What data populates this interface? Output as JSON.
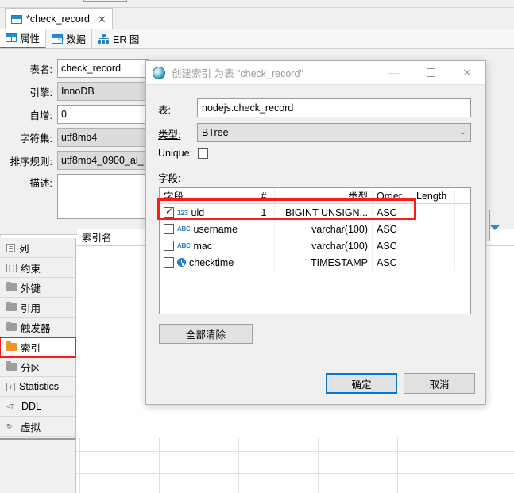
{
  "editor": {
    "tab_title": "*check_record",
    "close_label": "✕",
    "subtabs": [
      {
        "label": "属性",
        "icon": "table-icon",
        "active": true
      },
      {
        "label": "数据",
        "icon": "data-icon",
        "active": false
      },
      {
        "label": "ER 图",
        "icon": "er-diagram-icon",
        "active": false
      }
    ]
  },
  "properties": {
    "rows": [
      {
        "label": "表名:",
        "value": "check_record",
        "type": "text"
      },
      {
        "label": "引擎:",
        "value": "InnoDB",
        "type": "combo"
      },
      {
        "label": "自增:",
        "value": "0",
        "type": "text"
      },
      {
        "label": "字符集:",
        "value": "utf8mb4",
        "type": "combo"
      },
      {
        "label": "排序规则:",
        "value": "utf8mb4_0900_ai_",
        "type": "combo"
      },
      {
        "label": "描述:",
        "value": "",
        "type": "textarea"
      }
    ]
  },
  "nav": {
    "items": [
      {
        "label": "列",
        "icon": "columns-icon",
        "selected": false
      },
      {
        "label": "约束",
        "icon": "constraint-icon",
        "selected": false
      },
      {
        "label": "外键",
        "icon": "folder-icon",
        "selected": false
      },
      {
        "label": "引用",
        "icon": "folder-icon",
        "selected": false
      },
      {
        "label": "触发器",
        "icon": "folder-icon",
        "selected": false
      },
      {
        "label": "索引",
        "icon": "folder-icon-orange",
        "selected": true
      },
      {
        "label": "分区",
        "icon": "folder-icon",
        "selected": false
      },
      {
        "label": "Statistics",
        "icon": "info-icon",
        "selected": false
      },
      {
        "label": "DDL",
        "icon": "ddl-icon",
        "selected": false
      },
      {
        "label": "虚拟",
        "icon": "virtual-icon",
        "selected": false
      }
    ]
  },
  "index_grid": {
    "column_header": "索引名"
  },
  "dialog": {
    "title": "创建索引 为表 \"check_record\"",
    "icon": "app-logo-icon",
    "window_buttons": {
      "minimize": "—",
      "maximize": "□",
      "close": "✕"
    },
    "fields": {
      "table_label": "表:",
      "table_value": "nodejs.check_record",
      "type_label": "类型:",
      "type_value": "BTree",
      "type_chevron": "⌄",
      "unique_label": "Unique:",
      "unique_checked": false,
      "columns_label": "字段:"
    },
    "field_table": {
      "headers": [
        "字段",
        "#",
        "类型",
        "Order",
        "Length"
      ],
      "rows": [
        {
          "checked": true,
          "icon": "number-type-icon",
          "name": "uid",
          "num": "1",
          "type": "BIGINT UNSIGN...",
          "order": "ASC",
          "length": ""
        },
        {
          "checked": false,
          "icon": "string-type-icon",
          "name": "username",
          "num": "",
          "type": "varchar(100)",
          "order": "ASC",
          "length": ""
        },
        {
          "checked": false,
          "icon": "string-type-icon",
          "name": "mac",
          "num": "",
          "type": "varchar(100)",
          "order": "ASC",
          "length": ""
        },
        {
          "checked": false,
          "icon": "datetime-type-icon",
          "name": "checktime",
          "num": "",
          "type": "TIMESTAMP",
          "order": "ASC",
          "length": ""
        }
      ]
    },
    "buttons": {
      "clear_all": "全部清除",
      "ok": "确定",
      "cancel": "取消"
    }
  },
  "colors": {
    "accent_blue": "#0078d7",
    "highlight_red": "#ff1a1a",
    "folder_orange": "#f29527",
    "icon_blue": "#2a7fc0"
  }
}
